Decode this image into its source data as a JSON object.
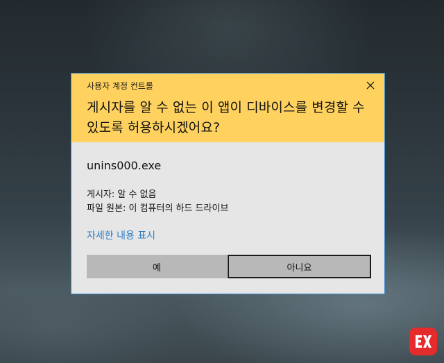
{
  "dialog": {
    "caption": "사용자 계정 컨트롤",
    "question": "게시자를 알 수 없는 이 앱이 디바이스를 변경할 수 있도록 허용하시겠어요?",
    "app_name": "unins000.exe",
    "publisher_line": "게시자: 알 수 없음",
    "origin_line": "파일 원본: 이 컴퓨터의 하드 드라이브",
    "details_link": "자세한 내용 표시",
    "yes_label": "예",
    "no_label": "아니요"
  },
  "icons": {
    "close": "close-icon",
    "logo": "brand-logo-icon"
  },
  "colors": {
    "header_bg": "#ffd25f",
    "body_bg": "#e6e6e6",
    "link": "#2e7ec6",
    "button_bg": "#b8b8b8",
    "border_accent": "#3f8fd6",
    "logo_bg": "#e52b2b"
  }
}
